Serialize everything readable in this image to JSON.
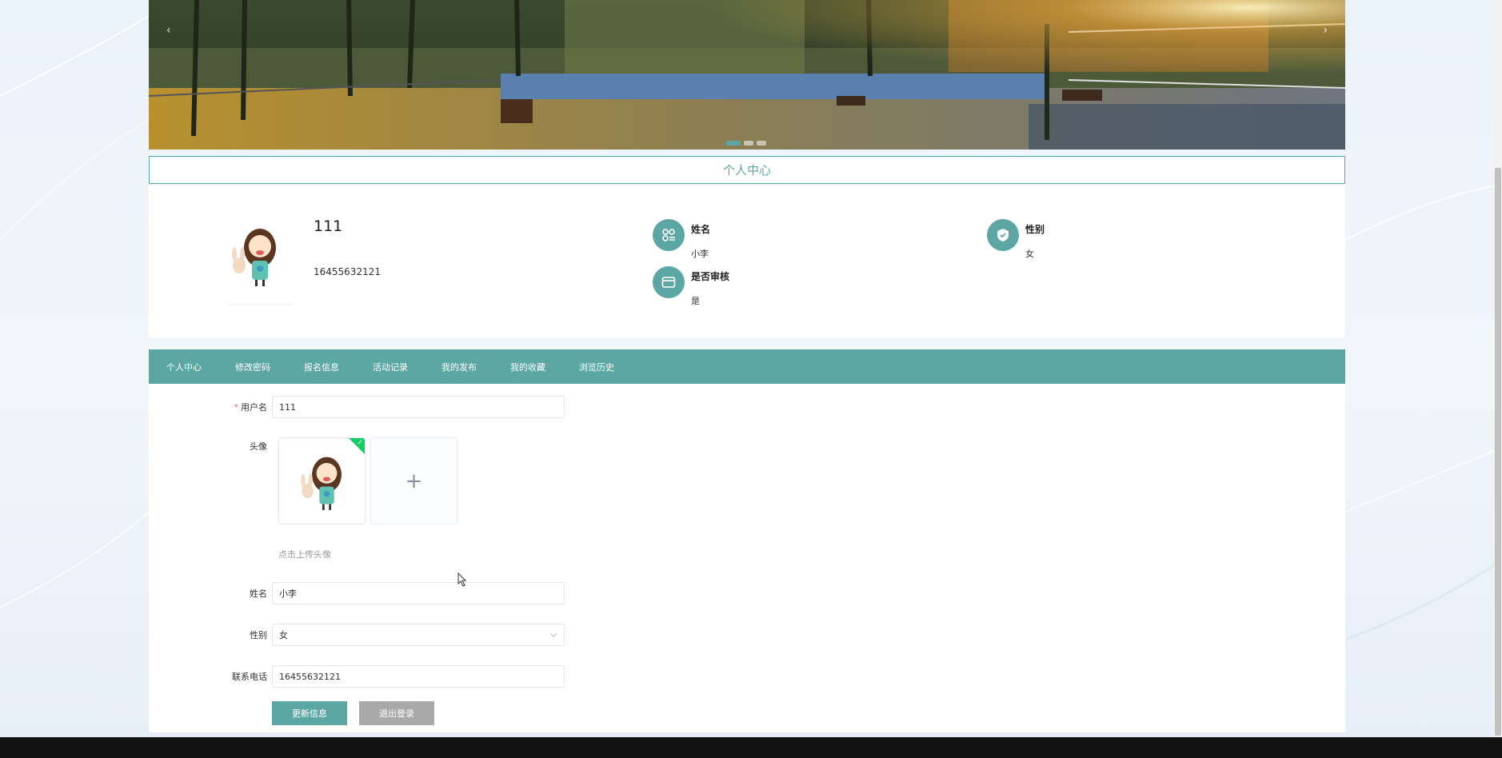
{
  "colors": {
    "accent": "#5ca7a3",
    "required": "#f56c6c",
    "upload_success": "#13ce66",
    "secondary_button": "#a9a9a9"
  },
  "banner": {
    "prev_icon": "‹",
    "next_icon": "›",
    "slide_count": 3,
    "active_slide": 1
  },
  "page_title": "个人中心",
  "profile": {
    "username": "111",
    "phone": "16455632121",
    "fields": [
      {
        "label": "姓名",
        "value": "小李",
        "icon": "apps-icon"
      },
      {
        "label": "性别",
        "value": "女",
        "icon": "shield-icon"
      },
      {
        "label": "是否审核",
        "value": "是",
        "icon": "card-icon"
      }
    ]
  },
  "tabs": [
    "个人中心",
    "修改密码",
    "报名信息",
    "活动记录",
    "我的发布",
    "我的收藏",
    "浏览历史"
  ],
  "form": {
    "username_label": "用户名",
    "username_value": "111",
    "avatar_label": "头像",
    "upload_plus": "+",
    "upload_hint": "点击上传头像",
    "name_label": "姓名",
    "name_value": "小李",
    "gender_label": "性别",
    "gender_value": "女",
    "phone_label": "联系电话",
    "phone_value": "16455632121",
    "update_button": "更新信息",
    "logout_button": "退出登录"
  }
}
